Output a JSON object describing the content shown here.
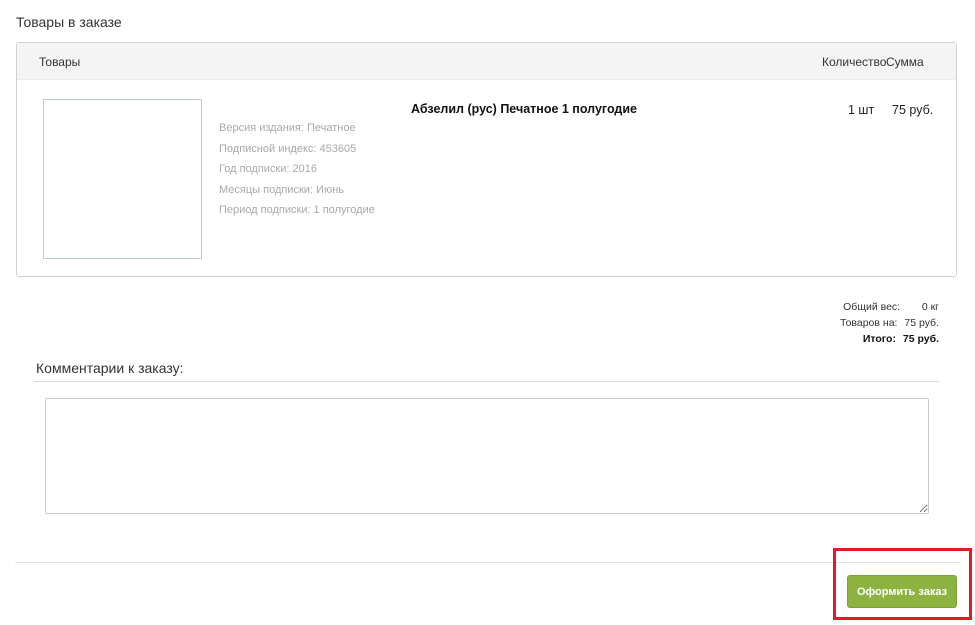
{
  "order": {
    "title": "Товары в заказе",
    "table": {
      "col_goods": "Товары",
      "col_qty": "Количество",
      "col_sum": "Сумма"
    },
    "item": {
      "name": "Абзелил (рус) Печатное 1 полугодие",
      "props": [
        "Версия издания: Печатное",
        "Подписной индекс: 453605",
        "Год подписки: 2016",
        "Месяцы подписки: Июнь",
        "Период подписки: 1 полугодие"
      ],
      "quantity": "1 шт",
      "sum": "75 руб."
    },
    "totals": {
      "weight_label": "Общий вес:",
      "weight_value": "0 кг",
      "goods_label": "Товаров на:",
      "goods_value": "75 руб.",
      "total_label": "Итого:",
      "total_value": "75 руб."
    }
  },
  "comments": {
    "title": "Комментарии к заказу:",
    "value": ""
  },
  "actions": {
    "submit_label": "Оформить заказ",
    "button_color": "#8cb33f",
    "highlight_color": "#e01b24"
  }
}
